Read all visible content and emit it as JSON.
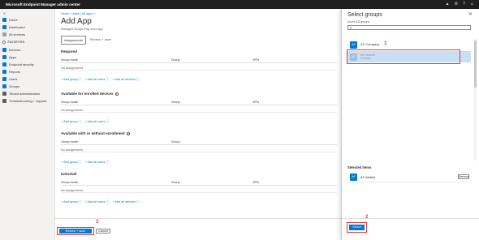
{
  "app": {
    "title": "Microsoft Endpoint Manager admin center"
  },
  "topbar_icons": [
    "bell-icon",
    "gear-icon",
    "help-icon",
    "smiley-icon"
  ],
  "sidebar": {
    "collapse_icon": "double-chevron-left-icon",
    "items": [
      {
        "label": "Home",
        "icon": "home-icon",
        "color": "#0078d4"
      },
      {
        "label": "Dashboard",
        "icon": "dashboard-icon",
        "color": "#0078d4"
      },
      {
        "label": "All services",
        "icon": "list-icon",
        "color": "#605e5c"
      },
      {
        "label": "FAVORITES",
        "icon": "star-icon",
        "color": "#605e5c"
      },
      {
        "label": "Devices",
        "icon": "devices-icon",
        "color": "#0078d4"
      },
      {
        "label": "Apps",
        "icon": "apps-icon",
        "color": "#0078d4"
      },
      {
        "label": "Endpoint security",
        "icon": "shield-icon",
        "color": "#0078d4"
      },
      {
        "label": "Reports",
        "icon": "reports-icon",
        "color": "#0078d4"
      },
      {
        "label": "Users",
        "icon": "user-icon",
        "color": "#0078d4"
      },
      {
        "label": "Groups",
        "icon": "groups-icon",
        "color": "#0078d4"
      },
      {
        "label": "Tenant administration",
        "icon": "tenant-icon",
        "color": "#605e5c"
      },
      {
        "label": "Troubleshooting + support",
        "icon": "wrench-icon",
        "color": "#605e5c"
      }
    ]
  },
  "main": {
    "breadcrumb": "Home > Apps | All apps >",
    "title": "Add App",
    "subtitle": "Managed Google Play store app",
    "tabs": [
      {
        "label": "Assignments",
        "active": true
      },
      {
        "label": "Review + save",
        "active": false
      }
    ],
    "columns": {
      "group_mode": "Group mode",
      "group": "Group",
      "vpn": "VPN"
    },
    "no_assignments": "No assignments",
    "links": {
      "add_group": "+ Add group ⓘ",
      "add_all_users": "+ Add all users ⓘ",
      "add_all_devices": "+ Add all devices ⓘ"
    },
    "sections": [
      {
        "title": "Required"
      },
      {
        "title": "Available for enrolled devices"
      },
      {
        "title": "Available with or without enrollment"
      },
      {
        "title": "Uninstall"
      }
    ],
    "footer": {
      "primary": "Review + save",
      "secondary": "Cancel"
    }
  },
  "panel": {
    "title": "Select groups",
    "close_icon": "close-icon",
    "subtitle": "Azure AD groups",
    "search_icon": "search-icon",
    "groups": [
      {
        "initials": "AF",
        "name": "AF Company",
        "status": ""
      },
      {
        "initials": "AF",
        "name": "AF-Mobile",
        "status": "Selected"
      }
    ],
    "selected_title": "Selected items",
    "selected_items": [
      {
        "initials": "AF",
        "name": "AF-Mobile",
        "remove": "Remove"
      }
    ],
    "select_label": "Select"
  },
  "callouts": {
    "one": "1",
    "two": "2",
    "three": "3"
  },
  "colors": {
    "accent": "#0078d4",
    "highlight": "#e53935",
    "topbar": "#1f1f1f"
  }
}
